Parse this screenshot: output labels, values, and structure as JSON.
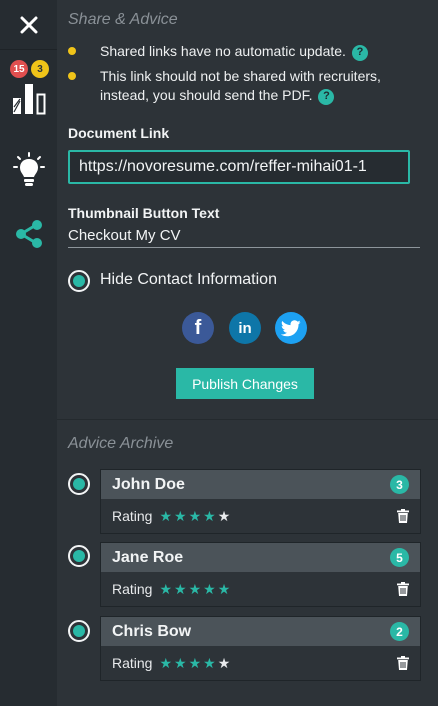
{
  "sidebar": {
    "close_glyph": "✕",
    "badges": {
      "red": "15",
      "yellow": "3"
    },
    "items": [
      {
        "name": "bar-chart-icon"
      },
      {
        "name": "lightbulb-icon"
      },
      {
        "name": "share-icon"
      }
    ]
  },
  "share_advice": {
    "title": "Share & Advice",
    "notes": [
      "Shared links have no automatic update.",
      "This link should not be shared with recruiters, instead, you should send the PDF."
    ],
    "help_glyph": "?",
    "document_link_label": "Document Link",
    "document_link_value": "https://novoresume.com/reffer-mihai01-1",
    "thumbnail_label": "Thumbnail Button Text",
    "thumbnail_value": "Checkout My CV",
    "hide_contact_label": "Hide Contact Information",
    "hide_contact_selected": true,
    "social": {
      "facebook": "f",
      "linkedin": "in",
      "twitter": "twitter-bird-icon"
    },
    "publish_label": "Publish Changes"
  },
  "archive": {
    "title": "Advice Archive",
    "rating_label": "Rating",
    "items": [
      {
        "name": "John Doe",
        "count": "3",
        "rating": 4,
        "max": 5
      },
      {
        "name": "Jane Roe",
        "count": "5",
        "rating": 5,
        "max": 5
      },
      {
        "name": "Chris Bow",
        "count": "2",
        "rating": 4,
        "max": 5
      }
    ]
  },
  "colors": {
    "accent": "#2ab8a6",
    "star_on": "#2ab8a6",
    "star_off": "#e8eaec",
    "note_dot": "#f0c419",
    "badge_red": "#e04f4f",
    "badge_yellow": "#f0c419"
  }
}
